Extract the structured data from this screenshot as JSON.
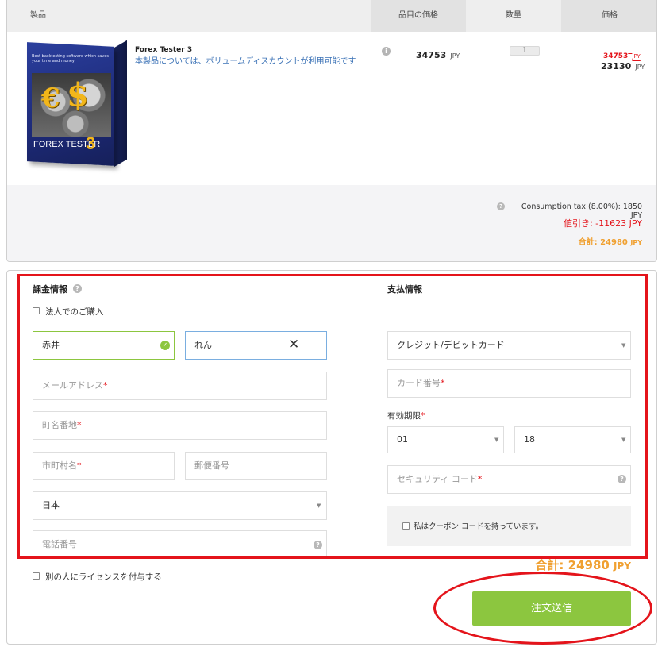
{
  "cart": {
    "headers": {
      "product": "製品",
      "unit_price": "品目の価格",
      "quantity": "数量",
      "price": "価格"
    },
    "item": {
      "box_tagline": "Best backtesting software which saves your time and money",
      "box_title": "FOREX TESTER",
      "box_version": "3",
      "name": "Forex Tester 3",
      "description": "本製品については、ボリュームディスカウントが利用可能です",
      "unit_price": "34753",
      "unit_price_currency": "JPY",
      "quantity": "1",
      "original_price": "34753",
      "original_currency": "JPY",
      "discounted_price": "23130",
      "discounted_currency": "JPY"
    },
    "summary": {
      "tax": "Consumption tax (8.00%): 1850 JPY",
      "discount": "値引き: -11623 JPY",
      "total_label": "合計: 24980",
      "total_currency": "JPY"
    }
  },
  "billing": {
    "title": "課金情報",
    "company_checkbox_label": "法人でのご購入",
    "last_name_value": "赤井",
    "first_name_value": "れん",
    "email_placeholder": "メールアドレス",
    "address_placeholder": "町名番地",
    "city_placeholder": "市町村名",
    "zip_placeholder": "郵便番号",
    "country_value": "日本",
    "phone_placeholder": "電話番号"
  },
  "payment": {
    "title": "支払情報",
    "method_value": "クレジット/デビットカード",
    "card_number_placeholder": "カード番号",
    "expiry_label": "有効期限",
    "expiry_month": "01",
    "expiry_year": "18",
    "cvc_placeholder": "セキュリティ コード",
    "coupon_checkbox_label": "私はクーポン コードを持っています。"
  },
  "footer": {
    "license_checkbox_label": "別の人にライセンスを付与する",
    "total_label": "合計: 24980",
    "total_currency": "JPY",
    "submit_label": "注文送信"
  },
  "colors": {
    "accent_green": "#8cc63f",
    "total_orange": "#f0a030",
    "discount_red": "#e4141b",
    "link_blue": "#3b72b6",
    "annotation_red": "#e4141b"
  },
  "icons": [
    "info-icon",
    "question-icon",
    "check-circle-icon",
    "clear-icon",
    "dropdown-caret-icon"
  ]
}
